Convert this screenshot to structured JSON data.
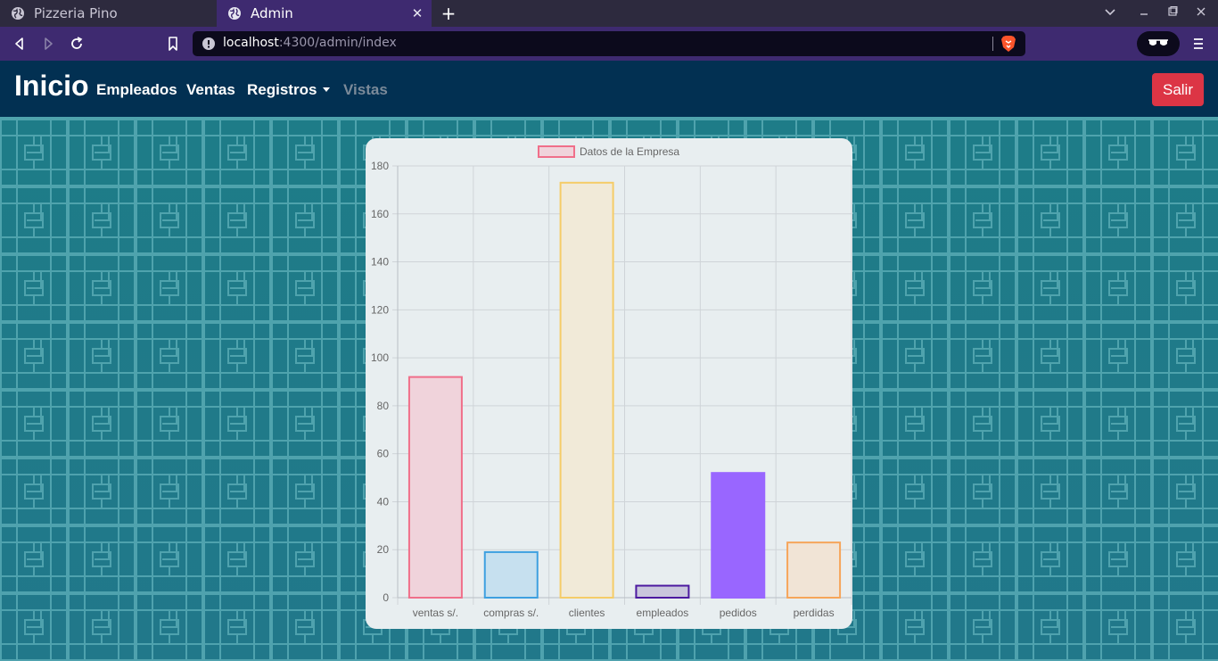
{
  "browser": {
    "tabs": [
      {
        "title": "Pizzeria Pino",
        "active": false
      },
      {
        "title": "Admin",
        "active": true
      }
    ],
    "new_tab_symbol": "+",
    "url_host": "localhost",
    "url_path": ":4300/admin/index",
    "icons": [
      "globe-icon",
      "back-icon",
      "forward-icon",
      "reload-icon",
      "bookmark-icon",
      "info-icon",
      "brave-lion-icon",
      "private-glasses-icon",
      "menu-icon",
      "minimize-icon",
      "maximize-icon",
      "close-icon",
      "chevron-down-icon"
    ]
  },
  "navbar": {
    "brand": "Inicio",
    "links": [
      {
        "label": "Empleados"
      },
      {
        "label": "Ventas"
      },
      {
        "label": "Registros"
      },
      {
        "label": "Vistas"
      }
    ],
    "logout_label": "Salir",
    "colors": {
      "background": "#023052",
      "logout": "#dc3545"
    }
  },
  "chart_data": {
    "type": "bar",
    "legend": "Datos de la Empresa",
    "legend_position": "top",
    "grid": true,
    "categories": [
      "ventas s/.",
      "compras s/.",
      "clientes",
      "empleados",
      "pedidos",
      "perdidas"
    ],
    "series": [
      {
        "name": "Datos de la Empresa",
        "values": [
          92,
          19,
          173,
          5,
          52,
          23
        ]
      }
    ],
    "ylim": [
      0,
      180
    ],
    "yticks": [
      0,
      20,
      40,
      60,
      80,
      100,
      120,
      140,
      160,
      180
    ],
    "bar_colors": [
      {
        "fill": "#f0d3db",
        "stroke": "#f06f8a"
      },
      {
        "fill": "#c6e0ef",
        "stroke": "#3ea0e0"
      },
      {
        "fill": "#f1ead8",
        "stroke": "#f5cc68"
      },
      {
        "fill": "#c9c6dc",
        "stroke": "#4c1aa0"
      },
      {
        "fill": "#9966ff",
        "stroke": "#9966ff"
      },
      {
        "fill": "#f1e4d6",
        "stroke": "#f6a55a"
      }
    ]
  }
}
